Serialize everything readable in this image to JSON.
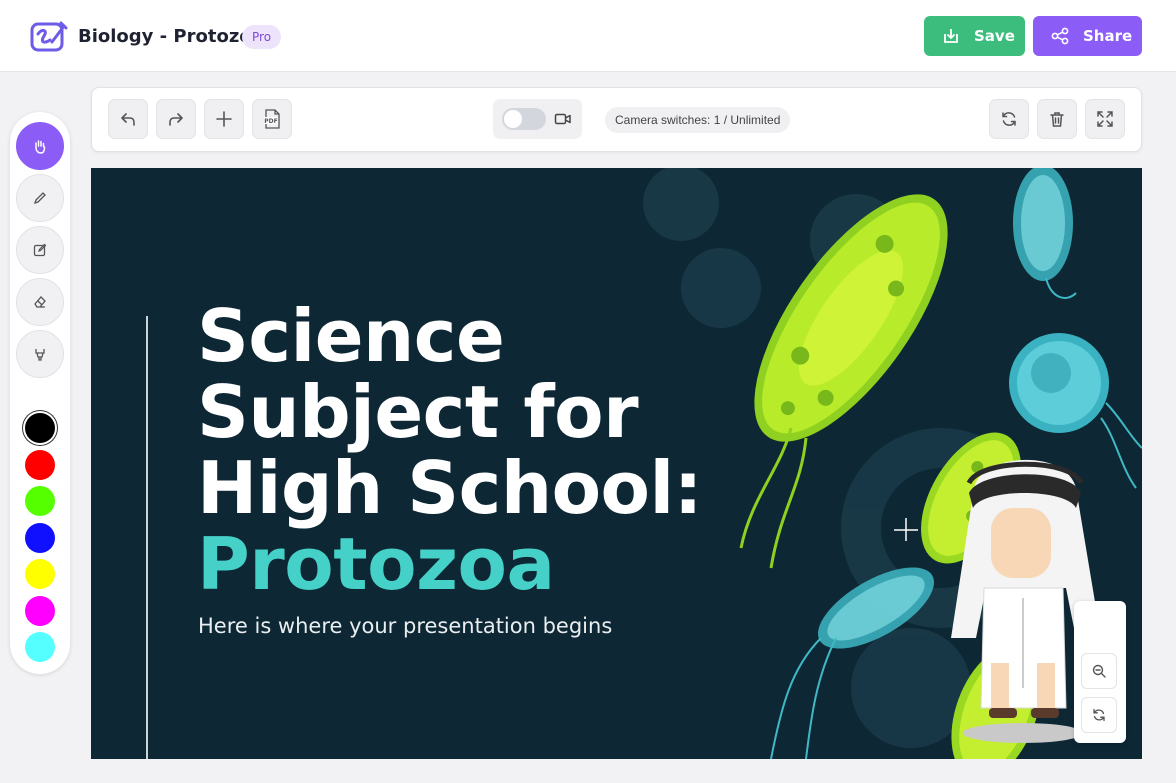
{
  "header": {
    "title": "Biology - Protozoa",
    "badge": "Pro",
    "save_label": "Save",
    "share_label": "Share"
  },
  "toolbar": {
    "buttons": [
      "undo-icon",
      "redo-icon",
      "add-icon",
      "pdf-icon"
    ],
    "camera_toggle": "off",
    "camera_switches_text": "Camera switches: 1 / Unlimited",
    "right_buttons": [
      "refresh-icon",
      "trash-icon",
      "fullscreen-icon"
    ]
  },
  "palette": {
    "tools": [
      "hand-icon",
      "pencil-icon",
      "edit-icon",
      "eraser-icon",
      "highlighter-icon"
    ],
    "active_tool": "hand-icon",
    "colors": [
      "#000000",
      "#ff0000",
      "#55ff00",
      "#1010ff",
      "#ffff00",
      "#ff00ff",
      "#55ffff"
    ]
  },
  "slide": {
    "line1": "Science",
    "line2": "Subject for",
    "line3": "High School:",
    "line4": "Protozoa",
    "subtitle": "Here is where your presentation begins",
    "accent_color": "#45d1c8",
    "background_color": "#0d2734"
  },
  "colors": {
    "save": "#3dbd7d",
    "share": "#8b5cf6",
    "active_tool": "#8b5cf6"
  }
}
